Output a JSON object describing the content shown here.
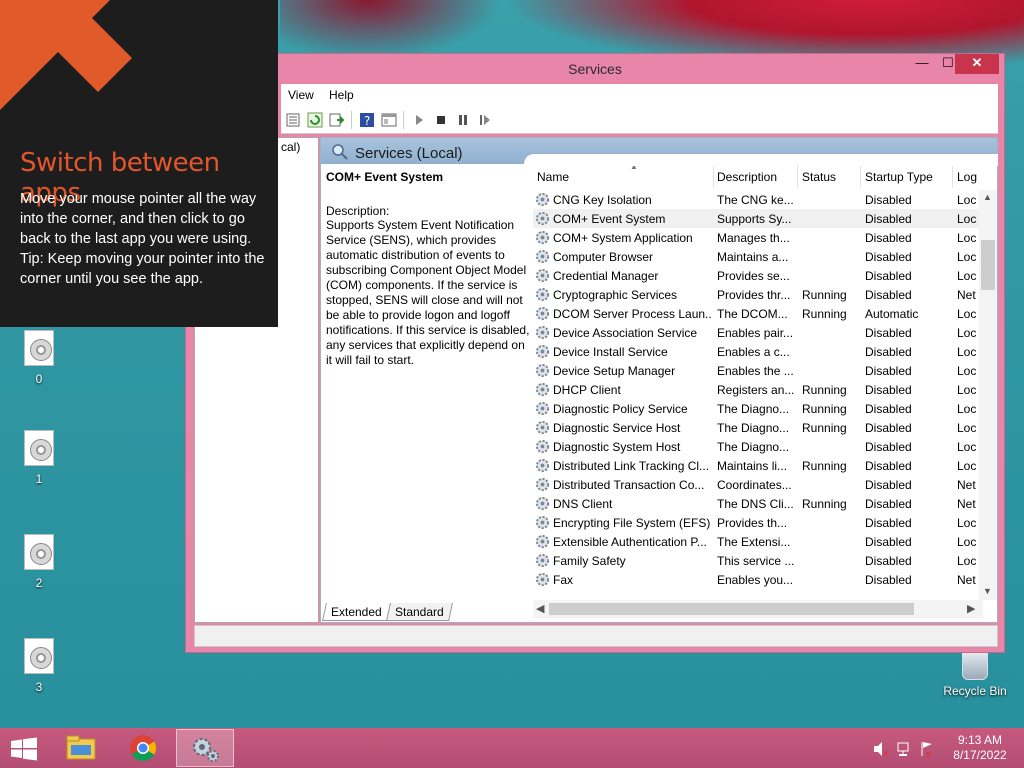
{
  "hint": {
    "title": "Switch between apps",
    "body": "Move your mouse pointer all the way into the corner, and then click to go back to the last app you were using.\nTip: Keep moving your pointer into the corner until you see the app."
  },
  "window": {
    "title": "Services",
    "controls": {
      "minimize": "—",
      "maximize": "☐",
      "close": "✕"
    }
  },
  "menu": {
    "view": "View",
    "help": "Help"
  },
  "left_pane": {
    "node_label": "cal)"
  },
  "content": {
    "header_title": "Services (Local)",
    "selected_service": "COM+ Event System",
    "description_label": "Description:",
    "description_text": "Supports System Event Notification Service (SENS), which provides automatic distribution of events to subscribing Component Object Model (COM) components. If the service is stopped, SENS will close and will not be able to provide logon and logoff notifications. If this service is disabled, any services that explicitly depend on it will fail to start."
  },
  "columns": {
    "name": "Name",
    "description": "Description",
    "status": "Status",
    "startup": "Startup Type",
    "log": "Log"
  },
  "services": [
    {
      "name": "CNG Key Isolation",
      "description": "The CNG ke...",
      "status": "",
      "startup": "Disabled",
      "log": "Loc"
    },
    {
      "name": "COM+ Event System",
      "description": "Supports Sy...",
      "status": "",
      "startup": "Disabled",
      "log": "Loc"
    },
    {
      "name": "COM+ System Application",
      "description": "Manages th...",
      "status": "",
      "startup": "Disabled",
      "log": "Loc"
    },
    {
      "name": "Computer Browser",
      "description": "Maintains a...",
      "status": "",
      "startup": "Disabled",
      "log": "Loc"
    },
    {
      "name": "Credential Manager",
      "description": "Provides se...",
      "status": "",
      "startup": "Disabled",
      "log": "Loc"
    },
    {
      "name": "Cryptographic Services",
      "description": "Provides thr...",
      "status": "Running",
      "startup": "Disabled",
      "log": "Net"
    },
    {
      "name": "DCOM Server Process Laun...",
      "description": "The DCOM...",
      "status": "Running",
      "startup": "Automatic",
      "log": "Loc"
    },
    {
      "name": "Device Association Service",
      "description": "Enables pair...",
      "status": "",
      "startup": "Disabled",
      "log": "Loc"
    },
    {
      "name": "Device Install Service",
      "description": "Enables a c...",
      "status": "",
      "startup": "Disabled",
      "log": "Loc"
    },
    {
      "name": "Device Setup Manager",
      "description": "Enables the ...",
      "status": "",
      "startup": "Disabled",
      "log": "Loc"
    },
    {
      "name": "DHCP Client",
      "description": "Registers an...",
      "status": "Running",
      "startup": "Disabled",
      "log": "Loc"
    },
    {
      "name": "Diagnostic Policy Service",
      "description": "The Diagno...",
      "status": "Running",
      "startup": "Disabled",
      "log": "Loc"
    },
    {
      "name": "Diagnostic Service Host",
      "description": "The Diagno...",
      "status": "Running",
      "startup": "Disabled",
      "log": "Loc"
    },
    {
      "name": "Diagnostic System Host",
      "description": "The Diagno...",
      "status": "",
      "startup": "Disabled",
      "log": "Loc"
    },
    {
      "name": "Distributed Link Tracking Cl...",
      "description": "Maintains li...",
      "status": "Running",
      "startup": "Disabled",
      "log": "Loc"
    },
    {
      "name": "Distributed Transaction Co...",
      "description": "Coordinates...",
      "status": "",
      "startup": "Disabled",
      "log": "Net"
    },
    {
      "name": "DNS Client",
      "description": "The DNS Cli...",
      "status": "Running",
      "startup": "Disabled",
      "log": "Net"
    },
    {
      "name": "Encrypting File System (EFS)",
      "description": "Provides th...",
      "status": "",
      "startup": "Disabled",
      "log": "Loc"
    },
    {
      "name": "Extensible Authentication P...",
      "description": "The Extensi...",
      "status": "",
      "startup": "Disabled",
      "log": "Loc"
    },
    {
      "name": "Family Safety",
      "description": "This service ...",
      "status": "",
      "startup": "Disabled",
      "log": "Loc"
    },
    {
      "name": "Fax",
      "description": "Enables you...",
      "status": "",
      "startup": "Disabled",
      "log": "Net"
    }
  ],
  "tabs": {
    "extended": "Extended",
    "standard": "Standard"
  },
  "desktop_icons": [
    "0",
    "1",
    "2",
    "3"
  ],
  "recycle_bin": "Recycle Bin",
  "clock": {
    "time": "9:13 AM",
    "date": "8/17/2022"
  },
  "colors": {
    "window_frame": "#e885a8",
    "taskbar": "#c65a7e",
    "hint_title": "#e2562b",
    "close_button": "#c7344b"
  }
}
